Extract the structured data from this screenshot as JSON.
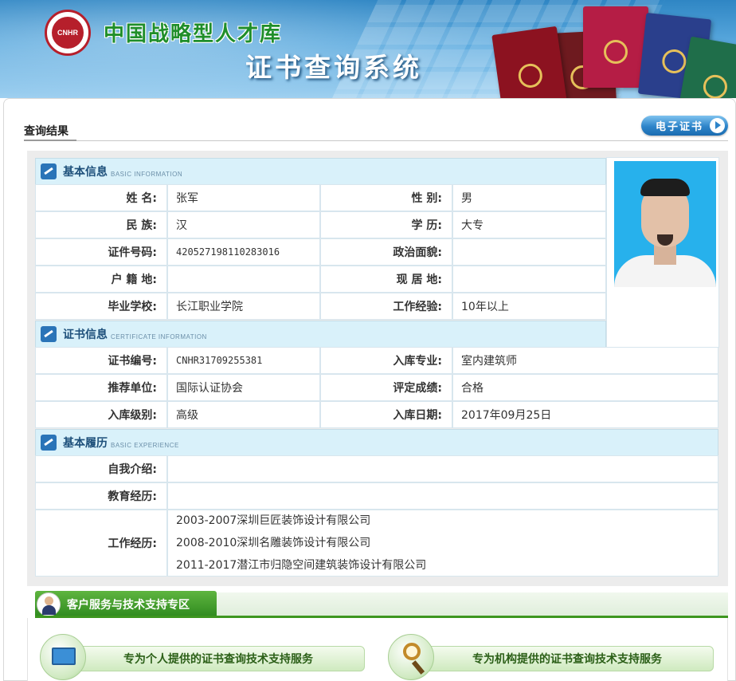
{
  "header": {
    "logo_text": "CNHR",
    "site_title": "中国战略型人才库",
    "system_title": "证书查询系统"
  },
  "result": {
    "label": "查询结果",
    "ecert_button": "电子证书"
  },
  "basic_info": {
    "title": "基本信息",
    "subtitle": "BASIC INFORMATION",
    "name_label": "姓  名:",
    "name": "张军",
    "gender_label": "性  别:",
    "gender": "男",
    "ethnicity_label": "民  族:",
    "ethnicity": "汉",
    "education_label": "学  历:",
    "education": "大专",
    "id_label": "证件号码:",
    "id_number": "420527198110283016",
    "political_label": "政治面貌:",
    "political": "",
    "hukou_label": "户 籍 地:",
    "hukou": "",
    "residence_label": "现 居 地:",
    "residence": "",
    "school_label": "毕业学校:",
    "school": "长江职业学院",
    "experience_label": "工作经验:",
    "experience": "10年以上"
  },
  "certificate_info": {
    "title": "证书信息",
    "subtitle": "CERTIFICATE INFORMATION",
    "cert_no_label": "证书编号:",
    "cert_no": "CNHR31709255381",
    "major_label": "入库专业:",
    "major": "室内建筑师",
    "recommender_label": "推荐单位:",
    "recommender": "国际认证协会",
    "score_label": "评定成绩:",
    "score": "合格",
    "level_label": "入库级别:",
    "level": "高级",
    "date_label": "入库日期:",
    "date": "2017年09月25日"
  },
  "resume": {
    "title": "基本履历",
    "subtitle": "BASIC EXPERIENCE",
    "intro_label": "自我介绍:",
    "intro": "",
    "education_label": "教育经历:",
    "education": "",
    "work_label": "工作经历:",
    "work": [
      "2003-2007深圳巨匠装饰设计有限公司",
      "2008-2010深圳名雕装饰设计有限公司",
      "2011-2017潜江市归隐空间建筑装饰设计有限公司"
    ]
  },
  "support": {
    "title": "客户服务与技术支持专区",
    "personal": "专为个人提供的证书查询技术支持服务",
    "organization": "专为机构提供的证书查询技术支持服务"
  },
  "icons": [
    "logo-icon",
    "section-pen-icon",
    "arrow-right-icon",
    "agent-icon",
    "monitor-headset-icon",
    "magnifier-book-icon"
  ],
  "colors": {
    "banner_blue": "#2f86c4",
    "title_green": "#1f8e2a",
    "section_bg": "#d9f1fa",
    "support_green": "#3d961f",
    "button_blue": "#2d84c9"
  }
}
